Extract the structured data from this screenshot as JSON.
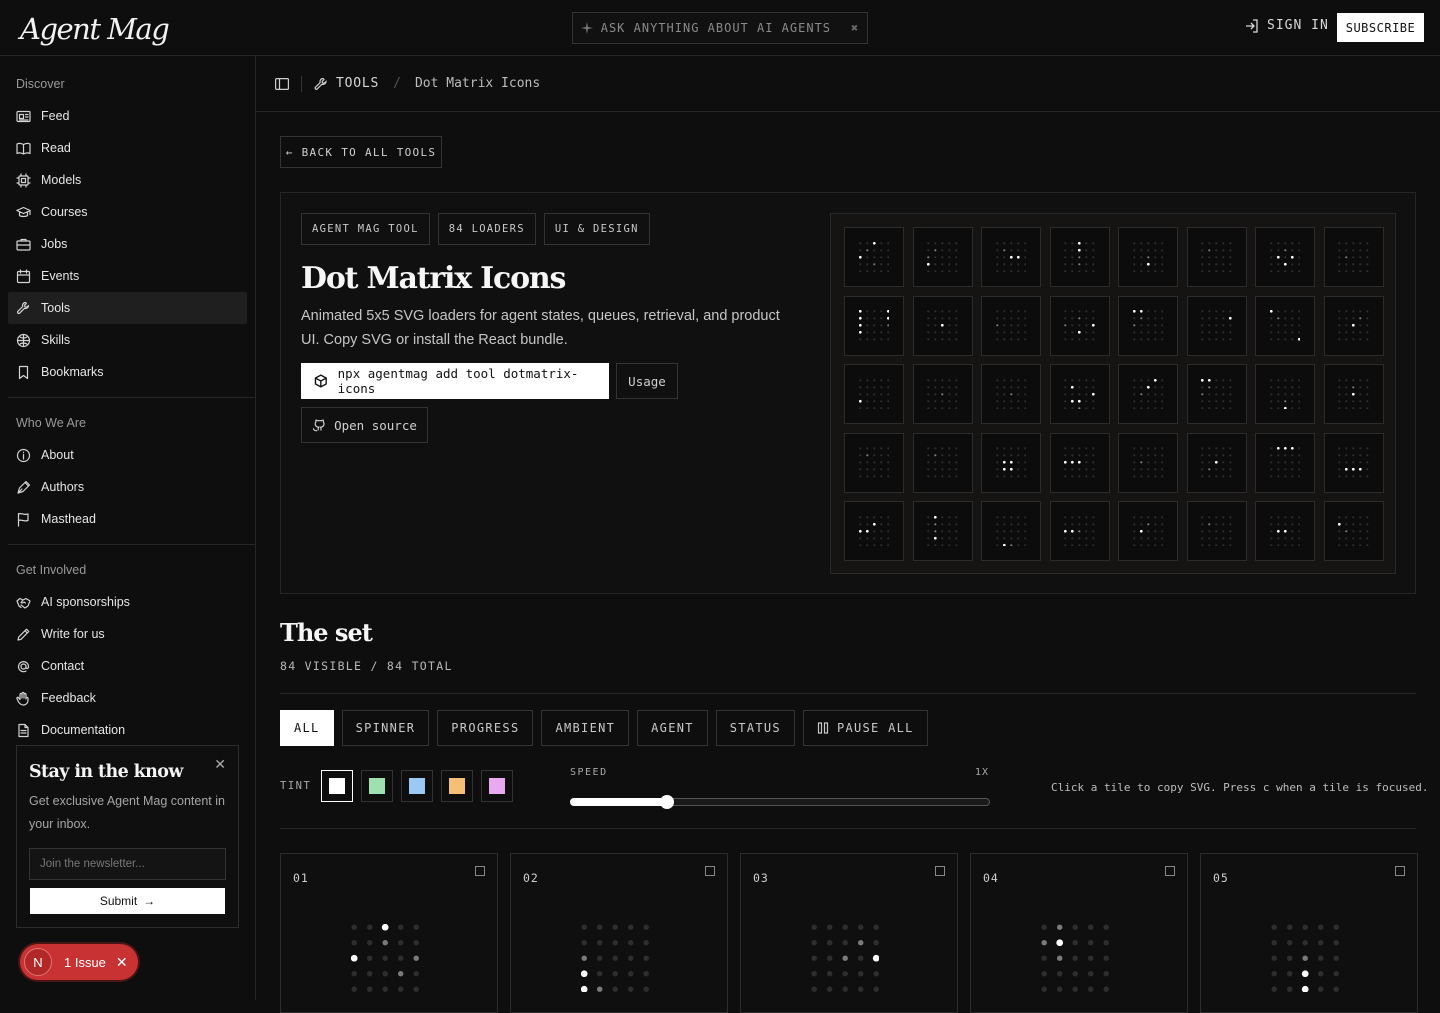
{
  "brand": {
    "logo": "Agent Mag"
  },
  "topbar": {
    "ask": "ASK ANYTHING ABOUT AI AGENTS",
    "sign_in": "SIGN IN",
    "subscribe": "SUBSCRIBE"
  },
  "sidebar": {
    "discover_title": "Discover",
    "discover": [
      {
        "label": "Feed",
        "icon": "feed-icon"
      },
      {
        "label": "Read",
        "icon": "book-icon"
      },
      {
        "label": "Models",
        "icon": "chip-icon"
      },
      {
        "label": "Courses",
        "icon": "graduation-cap-icon"
      },
      {
        "label": "Jobs",
        "icon": "briefcase-icon"
      },
      {
        "label": "Events",
        "icon": "calendar-icon"
      },
      {
        "label": "Tools",
        "icon": "wrench-icon",
        "active": true
      },
      {
        "label": "Skills",
        "icon": "brain-icon"
      },
      {
        "label": "Bookmarks",
        "icon": "bookmark-icon"
      }
    ],
    "who_title": "Who We Are",
    "who": [
      {
        "label": "About",
        "icon": "info-icon"
      },
      {
        "label": "Authors",
        "icon": "pen-nib-icon"
      },
      {
        "label": "Masthead",
        "icon": "flag-icon"
      }
    ],
    "involved_title": "Get Involved",
    "involved": [
      {
        "label": "AI sponsorships",
        "icon": "handshake-icon"
      },
      {
        "label": "Write for us",
        "icon": "pencil-icon"
      },
      {
        "label": "Contact",
        "icon": "at-icon"
      },
      {
        "label": "Feedback",
        "icon": "hand-icon"
      },
      {
        "label": "Documentation",
        "icon": "document-icon"
      }
    ]
  },
  "newsletter": {
    "title": "Stay in the know",
    "text": "Get exclusive Agent Mag content in your inbox.",
    "placeholder": "Join the newsletter...",
    "submit": "Submit"
  },
  "issue_badge": {
    "letter": "N",
    "label": "1 Issue"
  },
  "breadcrumb": {
    "section": "TOOLS",
    "separator": "/",
    "current": "Dot Matrix Icons"
  },
  "back_button": "BACK TO ALL TOOLS",
  "hero": {
    "tags": [
      "AGENT MAG TOOL",
      "84 LOADERS",
      "UI & DESIGN"
    ],
    "title": "Dot Matrix Icons",
    "description": "Animated 5x5 SVG loaders for agent states, queues, retrieval, and product UI. Copy SVG or install the React bundle.",
    "command": "npx agentmag add tool dotmatrix-icons",
    "usage": "Usage",
    "open_source": "Open source"
  },
  "set": {
    "title": "The set",
    "count": "84 VISIBLE / 84 TOTAL",
    "filters": [
      "ALL",
      "SPINNER",
      "PROGRESS",
      "AMBIENT",
      "AGENT",
      "STATUS"
    ],
    "active_filter": "ALL",
    "pause": "PAUSE ALL",
    "tint_label": "TINT",
    "tints": [
      "#ffffff",
      "#9fe0b0",
      "#9cc8f5",
      "#f5bf76",
      "#e9a9f0"
    ],
    "speed_label": "SPEED",
    "speed_value": "1X",
    "speed": 0.23,
    "hint": "Click a tile to copy SVG. Press c when a tile is focused."
  },
  "cards": [
    {
      "num": "01"
    },
    {
      "num": "02"
    },
    {
      "num": "03"
    },
    {
      "num": "04"
    },
    {
      "num": "05"
    }
  ]
}
